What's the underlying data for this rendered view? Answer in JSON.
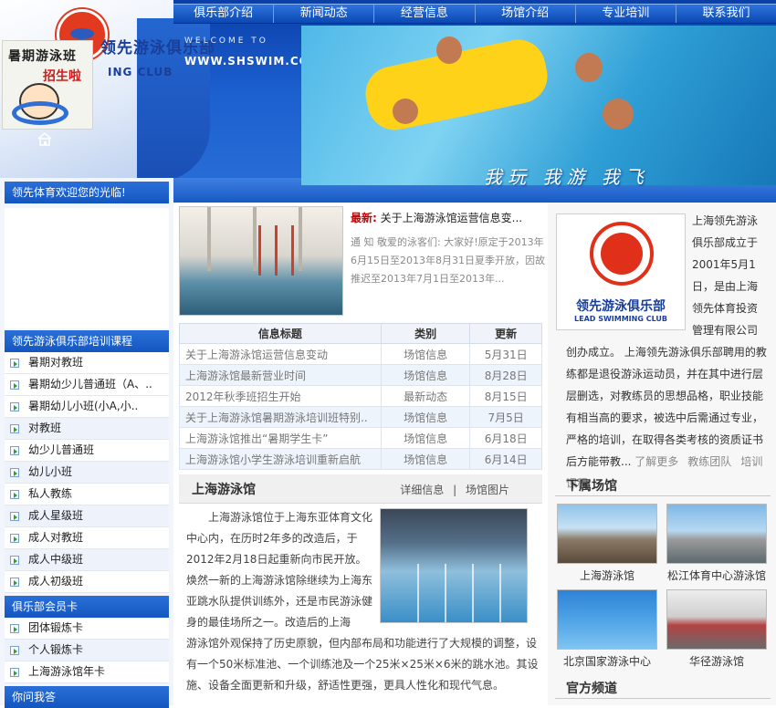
{
  "nav": [
    "俱乐部介绍",
    "新闻动态",
    "经营信息",
    "场馆介绍",
    "专业培训",
    "联系我们"
  ],
  "header": {
    "club_name": "领先游泳俱乐部",
    "club_sub": "ING CLUB",
    "promo_line1": "暑期游泳班",
    "promo_line2": "招生啦",
    "welcome": "WELCOME TO",
    "url": "WWW.SHSWIM.COM",
    "slogan": "我玩 我游 我飞"
  },
  "left": {
    "welcome_title": "领先体育欢迎您的光临!",
    "courses_title": "领先游泳俱乐部培训课程",
    "courses": [
      "暑期对教班",
      "暑期幼少儿普通班（A、..",
      "暑期幼儿小班(小A,小..",
      "对教班",
      "幼少儿普通班",
      "幼儿小班",
      "私人教练",
      "成人星级班",
      "成人对教班",
      "成人中级班",
      "成人初级班"
    ],
    "cards_title": "俱乐部会员卡",
    "cards": [
      "团体锻炼卡",
      "个人锻炼卡",
      "上海游泳馆年卡"
    ],
    "qa_title": "你问我答"
  },
  "center": {
    "latest_label": "最新:",
    "latest_title": "关于上海游泳馆运营信息变...",
    "latest_summary": "通 知 敬爱的泳客们: 大家好!原定于2013年6月15日至2013年8月31日夏季开放，因故推迟至2013年7月1日至2013年...",
    "table_headers": [
      "信息标题",
      "类别",
      "更新"
    ],
    "table_rows": [
      [
        "关于上海游泳馆运营信息变动",
        "场馆信息",
        "5月31日"
      ],
      [
        "上海游泳馆最新营业时间",
        "场馆信息",
        "8月28日"
      ],
      [
        "2012年秋季班招生开始",
        "最新动态",
        "8月15日"
      ],
      [
        "关于上海游泳馆暑期游泳培训班特别..",
        "场馆信息",
        "7月5日"
      ],
      [
        "上海游泳馆推出“暑期学生卡”",
        "场馆信息",
        "6月18日"
      ],
      [
        "上海游泳馆小学生游泳培训重新启航",
        "场馆信息",
        "6月14日"
      ]
    ],
    "venue_title": "上海游泳馆",
    "venue_link_detail": "详细信息",
    "venue_link_sep": "|",
    "venue_link_photos": "场馆图片",
    "venue_text_a": "上海游泳馆位于上海东亚体育文化中心内，在历时2年多的改造后，于2012年2月18日起重新向市民开放。焕然一新的上海游泳馆除继续为上海东亚跳水队提供训练外，还是市民游泳健身的最佳场所之一。改造后的上海",
    "venue_text_b": "游泳馆外观保持了历史原貌，但内部布局和功能进行了大规模的调整，设有一个50米标准池、一个训练池及一个25米×25米×6米的跳水池。其设施、设备全面更新和升级，舒适性更强，更具人性化和现代气息。"
  },
  "right": {
    "logo_text": "领先游泳俱乐部",
    "logo_sub": "LEAD SWIMMING CLUB",
    "intro_a": "上海领先游泳俱乐部成立于2001年5月1日，是由上海领先体育投资管理有限公司",
    "intro_b": "创办成立。 上海领先游泳俱乐部聘用的教练都是退役游泳运动员，并在其中进行层层删选，对教练员的思想品格，职业技能有相当高的要求，被选中后需通过专业，严格的培训，在取得各类考核的资质证书后方能带教...",
    "links": [
      "了解更多",
      "教练团队",
      "培训课程"
    ],
    "venues_title": "下属场馆",
    "venues": [
      "上海游泳馆",
      "松江体育中心游泳馆",
      "北京国家游泳中心",
      "华径游泳馆"
    ],
    "official_title": "官方频道"
  }
}
